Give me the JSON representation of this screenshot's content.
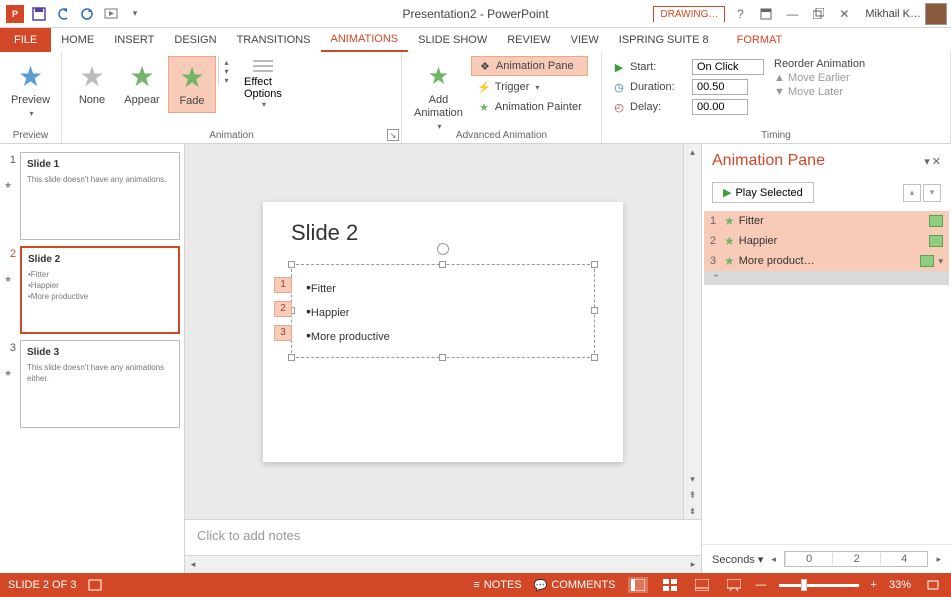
{
  "title": "Presentation2 - PowerPoint",
  "drawing_tab": "DRAWING…",
  "user": "Mikhail K…",
  "tabs": {
    "file": "FILE",
    "home": "HOME",
    "insert": "INSERT",
    "design": "DESIGN",
    "transitions": "TRANSITIONS",
    "animations": "ANIMATIONS",
    "slideshow": "SLIDE SHOW",
    "review": "REVIEW",
    "view": "VIEW",
    "ispring": "ISPRING SUITE 8",
    "format": "FORMAT"
  },
  "ribbon": {
    "preview": {
      "label": "Preview",
      "group": "Preview"
    },
    "animation": {
      "group": "Animation",
      "none": "None",
      "appear": "Appear",
      "fade": "Fade",
      "effect": "Effect\nOptions"
    },
    "advanced": {
      "group": "Advanced Animation",
      "add": "Add\nAnimation",
      "pane": "Animation Pane",
      "trigger": "Trigger",
      "painter": "Animation Painter"
    },
    "timing": {
      "group": "Timing",
      "start_lbl": "Start:",
      "start_val": "On Click",
      "duration_lbl": "Duration:",
      "duration_val": "00.50",
      "delay_lbl": "Delay:",
      "delay_val": "00.00",
      "reorder": "Reorder Animation",
      "earlier": "Move Earlier",
      "later": "Move Later"
    }
  },
  "thumbs": [
    {
      "n": "1",
      "title": "Slide 1",
      "body": "This slide doesn't have any animations."
    },
    {
      "n": "2",
      "title": "Slide 2",
      "body": "•Fitter\n•Happier\n•More productive"
    },
    {
      "n": "3",
      "title": "Slide 3",
      "body": "This slide doesn't have any animations either."
    }
  ],
  "slide": {
    "title": "Slide 2",
    "b1": "Fitter",
    "b2": "Happier",
    "b3": "More productive",
    "t1": "1",
    "t2": "2",
    "t3": "3"
  },
  "notes": "Click to add notes",
  "pane": {
    "title": "Animation Pane",
    "play": "Play Selected",
    "items": [
      {
        "n": "1",
        "t": "Fitter"
      },
      {
        "n": "2",
        "t": "Happier"
      },
      {
        "n": "3",
        "t": "More product…"
      }
    ],
    "seconds": "Seconds",
    "r0": "0",
    "r2": "2",
    "r4": "4"
  },
  "status": {
    "slide": "SLIDE 2 OF 3",
    "notes": "NOTES",
    "comments": "COMMENTS",
    "zoom": "33%"
  }
}
